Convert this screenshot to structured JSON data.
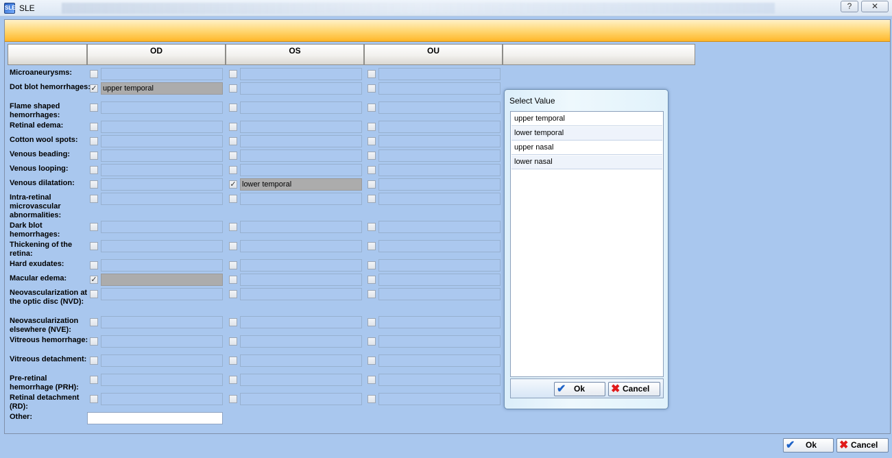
{
  "window": {
    "icon_text": "SLE",
    "title": "SLE",
    "help_label": "?",
    "close_label": "✕"
  },
  "columns": [
    "OD",
    "OS",
    "OU"
  ],
  "rows": [
    {
      "label": "Microaneurysms:",
      "od": {
        "checked": false,
        "value": ""
      },
      "os": {
        "checked": false,
        "value": ""
      },
      "ou": {
        "checked": false,
        "value": ""
      }
    },
    {
      "label": "Dot blot hemorrhages:",
      "od": {
        "checked": true,
        "value": "upper temporal"
      },
      "os": {
        "checked": false,
        "value": ""
      },
      "ou": {
        "checked": false,
        "value": ""
      }
    },
    {
      "label": "Flame shaped hemorrhages:",
      "od": {
        "checked": false,
        "value": ""
      },
      "os": {
        "checked": false,
        "value": ""
      },
      "ou": {
        "checked": false,
        "value": ""
      }
    },
    {
      "label": "Retinal edema:",
      "od": {
        "checked": false,
        "value": ""
      },
      "os": {
        "checked": false,
        "value": ""
      },
      "ou": {
        "checked": false,
        "value": ""
      }
    },
    {
      "label": "Cotton wool spots:",
      "od": {
        "checked": false,
        "value": ""
      },
      "os": {
        "checked": false,
        "value": ""
      },
      "ou": {
        "checked": false,
        "value": ""
      }
    },
    {
      "label": "Venous beading:",
      "od": {
        "checked": false,
        "value": ""
      },
      "os": {
        "checked": false,
        "value": ""
      },
      "ou": {
        "checked": false,
        "value": ""
      }
    },
    {
      "label": "Venous looping:",
      "od": {
        "checked": false,
        "value": ""
      },
      "os": {
        "checked": false,
        "value": ""
      },
      "ou": {
        "checked": false,
        "value": ""
      }
    },
    {
      "label": "Venous dilatation:",
      "od": {
        "checked": false,
        "value": ""
      },
      "os": {
        "checked": true,
        "value": "lower temporal"
      },
      "ou": {
        "checked": false,
        "value": ""
      }
    },
    {
      "label": "Intra-retinal microvascular abnormalities:",
      "od": {
        "checked": false,
        "value": ""
      },
      "os": {
        "checked": false,
        "value": ""
      },
      "ou": {
        "checked": false,
        "value": ""
      }
    },
    {
      "label": "Dark blot hemorrhages:",
      "od": {
        "checked": false,
        "value": ""
      },
      "os": {
        "checked": false,
        "value": ""
      },
      "ou": {
        "checked": false,
        "value": ""
      }
    },
    {
      "label": "Thickening of the retina:",
      "od": {
        "checked": false,
        "value": ""
      },
      "os": {
        "checked": false,
        "value": ""
      },
      "ou": {
        "checked": false,
        "value": ""
      }
    },
    {
      "label": "Hard exudates:",
      "od": {
        "checked": false,
        "value": ""
      },
      "os": {
        "checked": false,
        "value": ""
      },
      "ou": {
        "checked": false,
        "value": ""
      }
    },
    {
      "label": "Macular edema:",
      "od": {
        "checked": true,
        "value": ""
      },
      "os": {
        "checked": false,
        "value": ""
      },
      "ou": {
        "checked": false,
        "value": ""
      }
    },
    {
      "label": "Neovascularization at the optic disc (NVD):",
      "od": {
        "checked": false,
        "value": ""
      },
      "os": {
        "checked": false,
        "value": ""
      },
      "ou": {
        "checked": false,
        "value": ""
      }
    },
    {
      "label": "Neovascularization elsewhere (NVE):",
      "od": {
        "checked": false,
        "value": ""
      },
      "os": {
        "checked": false,
        "value": ""
      },
      "ou": {
        "checked": false,
        "value": ""
      }
    },
    {
      "label": "Vitreous hemorrhage:",
      "od": {
        "checked": false,
        "value": ""
      },
      "os": {
        "checked": false,
        "value": ""
      },
      "ou": {
        "checked": false,
        "value": ""
      }
    },
    {
      "label": "Vitreous detachment:",
      "od": {
        "checked": false,
        "value": ""
      },
      "os": {
        "checked": false,
        "value": ""
      },
      "ou": {
        "checked": false,
        "value": ""
      }
    },
    {
      "label": "Pre-retinal hemorrhage (PRH):",
      "od": {
        "checked": false,
        "value": ""
      },
      "os": {
        "checked": false,
        "value": ""
      },
      "ou": {
        "checked": false,
        "value": ""
      }
    },
    {
      "label": "Retinal detachment (RD):",
      "od": {
        "checked": false,
        "value": ""
      },
      "os": {
        "checked": false,
        "value": ""
      },
      "ou": {
        "checked": false,
        "value": ""
      }
    }
  ],
  "other": {
    "label": "Other:",
    "value": ""
  },
  "popup": {
    "title": "Select Value",
    "options": [
      "upper temporal",
      "lower temporal",
      "upper nasal",
      "lower nasal"
    ],
    "ok_label": "Ok",
    "cancel_label": "Cancel"
  },
  "footer": {
    "ok_label": "Ok",
    "cancel_label": "Cancel"
  },
  "icons": {
    "check": "check-icon",
    "ok": "checkmark-icon",
    "cancel": "x-icon"
  },
  "colors": {
    "background": "#a9c7ee",
    "accent_bar": "#ffd56e",
    "filled_field": "#acacac",
    "cancel_red": "#e01a1a",
    "ok_blue": "#1f63c7"
  }
}
